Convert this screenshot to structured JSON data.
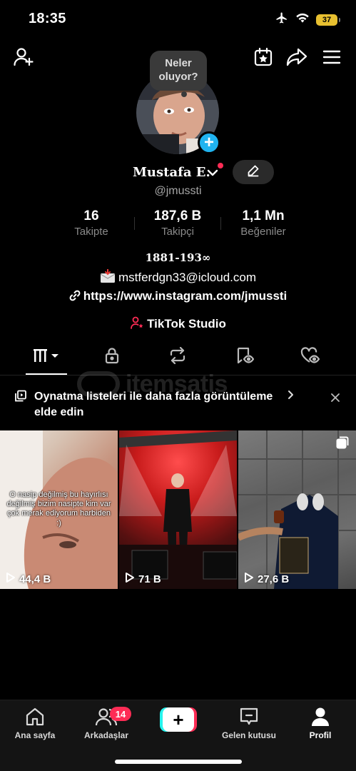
{
  "status_bar": {
    "time": "18:35",
    "battery": "37"
  },
  "bubble": {
    "text": "Neler oluyor?"
  },
  "profile": {
    "display_name": "Mustafa E.",
    "username": "@jmussti"
  },
  "stats": [
    {
      "value": "16",
      "label": "Takipte"
    },
    {
      "value": "187,6 B",
      "label": "Takipçi"
    },
    {
      "value": "1,1 Mn",
      "label": "Beğeniler"
    }
  ],
  "bio": {
    "years": "1881-193∞",
    "email": "mstferdgn33@icloud.com",
    "link": "https://www.instagram.com/jmussti",
    "studio": "TikTok Studio"
  },
  "watermark": {
    "text": "itemsatis"
  },
  "playlist_banner": {
    "text": "Oynatma listeleri ile daha fazla görüntüleme elde edin"
  },
  "videos": [
    {
      "caption": "O nasip değilmiş bu hayırlısı değilmiş bizim nasipte kim var çok merak ediyorum harbiden :)",
      "views": "44,4 B"
    },
    {
      "caption": "",
      "views": "71 B"
    },
    {
      "caption": "",
      "views": "27,6 B"
    }
  ],
  "nav": {
    "home": "Ana sayfa",
    "friends": "Arkadaşlar",
    "friends_badge": "14",
    "inbox": "Gelen kutusu",
    "profile": "Profil"
  },
  "colors": {
    "accent_red": "#fe2c55",
    "accent_cyan": "#25f4ee",
    "add_blue": "#20b3f0"
  }
}
